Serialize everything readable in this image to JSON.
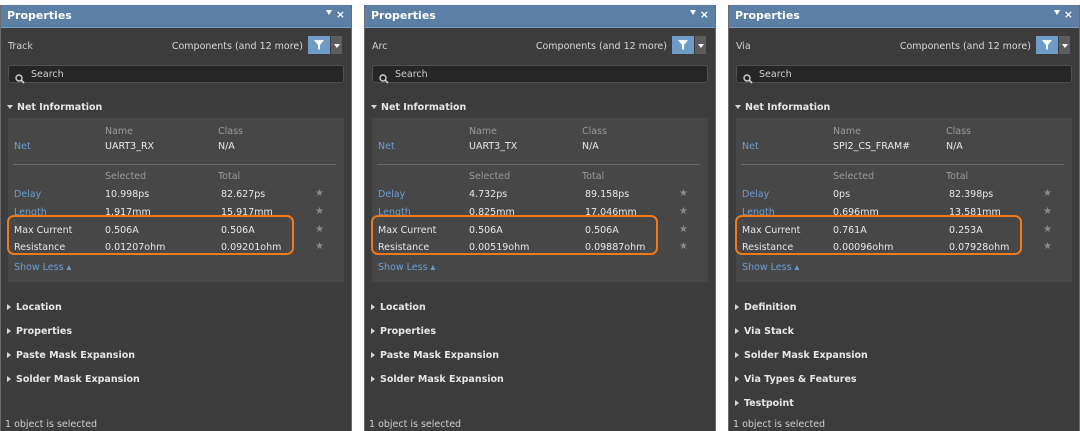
{
  "colors": {
    "panel_bg": "#3c3c3c",
    "titlebar": "#5b7fa5",
    "accent_blue": "#6e9fd3",
    "highlight": "#f07a1a"
  },
  "panels": [
    {
      "title": "Properties",
      "menu_icon": "triangle-down-icon",
      "close_glyph": "×",
      "object_type": "Track",
      "filter_text": "Components (and 12 more)",
      "search_placeholder": "Search",
      "net_section": "Net Information",
      "col_name": "Name",
      "col_class": "Class",
      "net_label": "Net",
      "net_name": "UART3_RX",
      "net_class": "N/A",
      "col_selected": "Selected",
      "col_total": "Total",
      "rows": [
        {
          "label": "Delay",
          "selected": "10.998ps",
          "total": "82.627ps"
        },
        {
          "label": "Length",
          "selected": "1.917mm",
          "total": "15.917mm"
        },
        {
          "label": "Max Current",
          "selected": "0.506A",
          "total": "0.506A"
        },
        {
          "label": "Resistance",
          "selected": "0.01207ohm",
          "total": "0.09201ohm"
        }
      ],
      "show_less": "Show Less ▴",
      "sections": [
        "Location",
        "Properties",
        "Paste Mask Expansion",
        "Solder Mask Expansion"
      ],
      "status": "1 object is selected"
    },
    {
      "title": "Properties",
      "menu_icon": "triangle-down-icon",
      "close_glyph": "×",
      "object_type": "Arc",
      "filter_text": "Components (and 12 more)",
      "search_placeholder": "Search",
      "net_section": "Net Information",
      "col_name": "Name",
      "col_class": "Class",
      "net_label": "Net",
      "net_name": "UART3_TX",
      "net_class": "N/A",
      "col_selected": "Selected",
      "col_total": "Total",
      "rows": [
        {
          "label": "Delay",
          "selected": "4.732ps",
          "total": "89.158ps"
        },
        {
          "label": "Length",
          "selected": "0.825mm",
          "total": "17.046mm"
        },
        {
          "label": "Max Current",
          "selected": "0.506A",
          "total": "0.506A"
        },
        {
          "label": "Resistance",
          "selected": "0.00519ohm",
          "total": "0.09887ohm"
        }
      ],
      "show_less": "Show Less ▴",
      "sections": [
        "Location",
        "Properties",
        "Paste Mask Expansion",
        "Solder Mask Expansion"
      ],
      "status": "1 object is selected"
    },
    {
      "title": "Properties",
      "menu_icon": "triangle-down-icon",
      "close_glyph": "×",
      "object_type": "Via",
      "filter_text": "Components (and 12 more)",
      "search_placeholder": "Search",
      "net_section": "Net Information",
      "col_name": "Name",
      "col_class": "Class",
      "net_label": "Net",
      "net_name": "SPI2_CS_FRAM#",
      "net_class": "N/A",
      "col_selected": "Selected",
      "col_total": "Total",
      "rows": [
        {
          "label": "Delay",
          "selected": "0ps",
          "total": "82.398ps"
        },
        {
          "label": "Length",
          "selected": "0.696mm",
          "total": "13.581mm"
        },
        {
          "label": "Max Current",
          "selected": "0.761A",
          "total": "0.253A"
        },
        {
          "label": "Resistance",
          "selected": "0.00096ohm",
          "total": "0.07928ohm"
        }
      ],
      "show_less": "Show Less ▴",
      "sections": [
        "Definition",
        "Via Stack",
        "Solder Mask Expansion",
        "Via Types & Features",
        "Testpoint"
      ],
      "status": "1 object is selected"
    }
  ]
}
